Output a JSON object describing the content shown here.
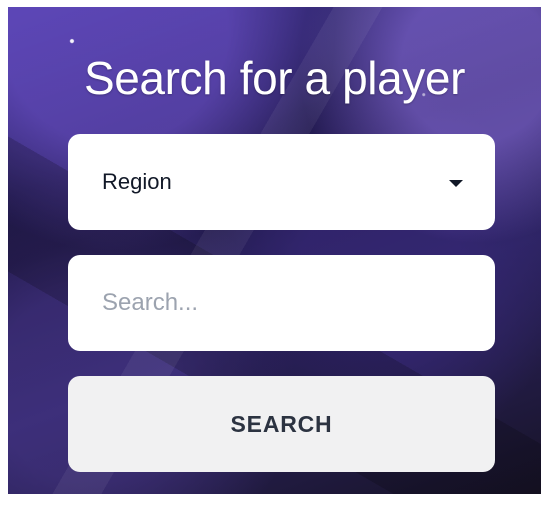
{
  "page": {
    "title": "Search for a player"
  },
  "form": {
    "region": {
      "selected": "Region",
      "icon": "chevron-down-icon"
    },
    "search": {
      "value": "",
      "placeholder": "Search..."
    },
    "submit": {
      "label": "SEARCH"
    }
  },
  "colors": {
    "text": "#ffffff",
    "field_background": "#ffffff",
    "button_background": "#f1f1f2",
    "button_text": "#2c3341",
    "placeholder_text": "#9ca3af"
  }
}
